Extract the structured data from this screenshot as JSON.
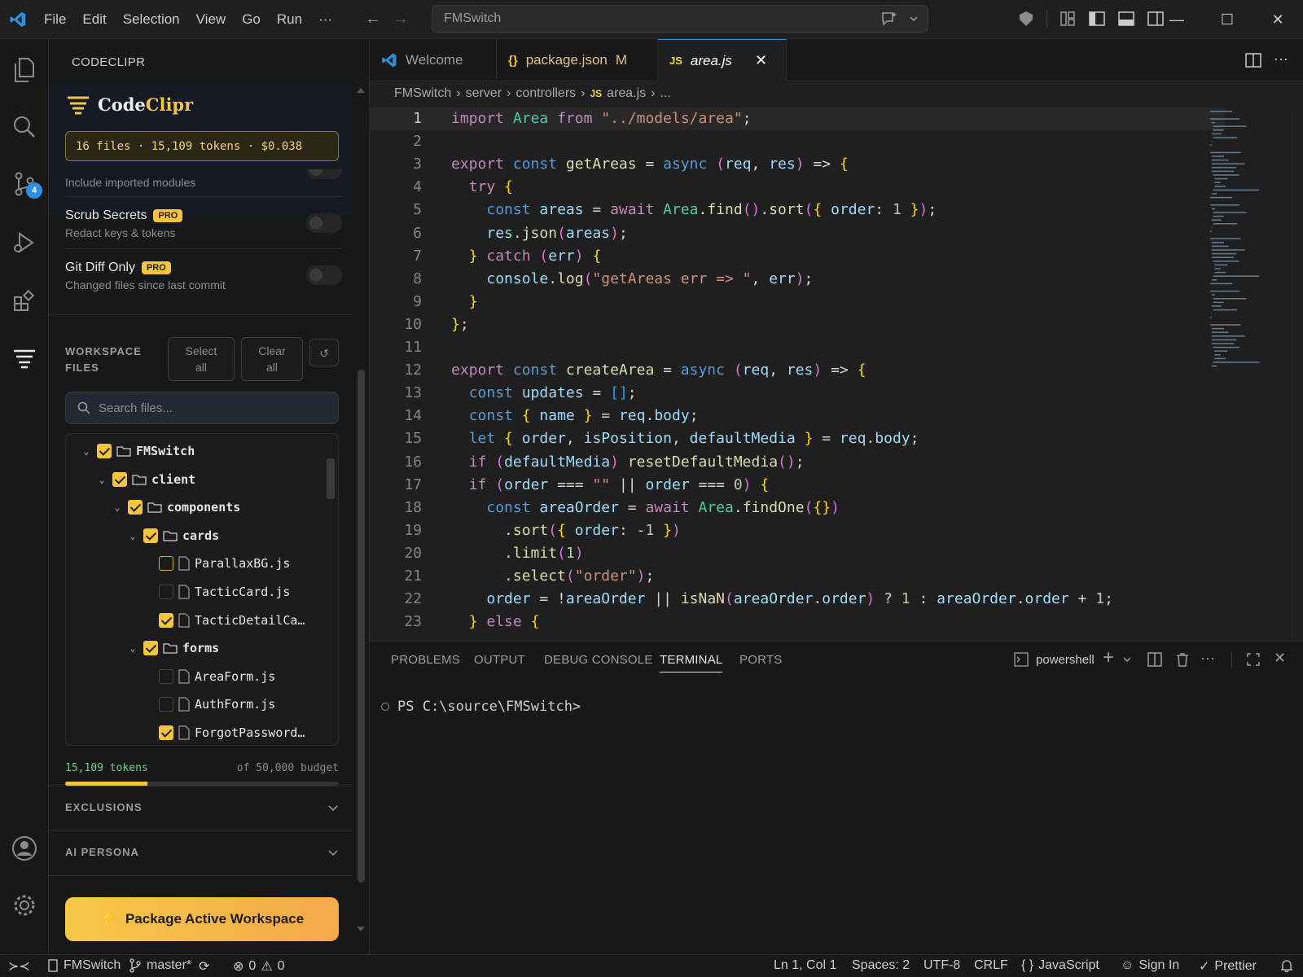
{
  "menu": [
    "File",
    "Edit",
    "Selection",
    "View",
    "Go",
    "Run",
    "···"
  ],
  "command_center": {
    "text": "FMSwitch"
  },
  "sidebar": {
    "title": "CODECLIPR",
    "brand": {
      "code": "Code",
      "clipr": "Clipr"
    },
    "stats": "16 files · 15,109 tokens · $0.038",
    "options": [
      {
        "label": "",
        "sub": "Include imported modules"
      },
      {
        "label": "Scrub Secrets",
        "badge": "PRO",
        "sub": "Redact keys & tokens"
      },
      {
        "label": "Git Diff Only",
        "badge": "PRO",
        "sub": "Changed files since last commit"
      }
    ],
    "workspace_title": "WORKSPACE FILES",
    "select_all": "Select all",
    "clear_all": "Clear all",
    "refresh_glyph": "↺",
    "search_placeholder": "Search files...",
    "tree": [
      {
        "name": "FMSwitch",
        "type": "folder",
        "depth": 0,
        "check": "on"
      },
      {
        "name": "client",
        "type": "folder",
        "depth": 1,
        "check": "on"
      },
      {
        "name": "components",
        "type": "folder",
        "depth": 2,
        "check": "on"
      },
      {
        "name": "cards",
        "type": "folder",
        "depth": 3,
        "check": "on"
      },
      {
        "name": "ParallaxBG.js",
        "type": "file",
        "depth": 4,
        "check": "partial"
      },
      {
        "name": "TacticCard.js",
        "type": "file",
        "depth": 4,
        "check": "off"
      },
      {
        "name": "TacticDetailCa…",
        "type": "file",
        "depth": 4,
        "check": "on"
      },
      {
        "name": "forms",
        "type": "folder",
        "depth": 3,
        "check": "on"
      },
      {
        "name": "AreaForm.js",
        "type": "file",
        "depth": 4,
        "check": "off"
      },
      {
        "name": "AuthForm.js",
        "type": "file",
        "depth": 4,
        "check": "off"
      },
      {
        "name": "ForgotPassword…",
        "type": "file",
        "depth": 4,
        "check": "on"
      }
    ],
    "tokens_used": "15,109 tokens",
    "budget": "of 50,000 budget",
    "budget_fraction": 0.302,
    "exclusions": "EXCLUSIONS",
    "ai_persona": "AI PERSONA",
    "package_button": "Package Active Workspace",
    "package_icon": "⚡"
  },
  "activity_badge": "4",
  "tabs": [
    {
      "label": "Welcome",
      "suffix": ""
    },
    {
      "label": "package.json",
      "suffix": "M",
      "icon": "{}"
    },
    {
      "label": "area.js",
      "suffix": "",
      "icon": "JS"
    }
  ],
  "breadcrumb": [
    "FMSwitch",
    "server",
    "controllers",
    "area.js",
    "..."
  ],
  "code_lines": [
    "import Area from \"../models/area\";",
    "",
    "export const getAreas = async (req, res) => {",
    "  try {",
    "    const areas = await Area.find().sort({ order: 1 });",
    "    res.json(areas);",
    "  } catch (err) {",
    "    console.log(\"getAreas err => \", err);",
    "  }",
    "};",
    "",
    "export const createArea = async (req, res) => {",
    "  const updates = [];",
    "  const { name } = req.body;",
    "  let { order, isPosition, defaultMedia } = req.body;",
    "  if (defaultMedia) resetDefaultMedia();",
    "  if (order === \"\" || order === 0) {",
    "    const areaOrder = await Area.findOne({})",
    "      .sort({ order: -1 })",
    "      .limit(1)",
    "      .select(\"order\");",
    "    order = !areaOrder || isNaN(areaOrder.order) ? 1 : areaOrder.order + 1;",
    "  } else {"
  ],
  "panel": {
    "tabs": [
      "PROBLEMS",
      "OUTPUT",
      "DEBUG CONSOLE",
      "TERMINAL",
      "PORTS"
    ],
    "active": "TERMINAL",
    "shell": "powershell",
    "prompt": "PS C:\\source\\FMSwitch>"
  },
  "status": {
    "workspace": "FMSwitch",
    "branch": "master*",
    "errors": "0",
    "warnings": "0",
    "position": "Ln 1, Col 1",
    "spaces": "Spaces: 2",
    "encoding": "UTF-8",
    "eol": "CRLF",
    "language": "JavaScript",
    "signin": "Sign In",
    "prettier": "Prettier"
  },
  "colors": {
    "accent": "#2d8fdd",
    "gold": "#f5c542"
  }
}
